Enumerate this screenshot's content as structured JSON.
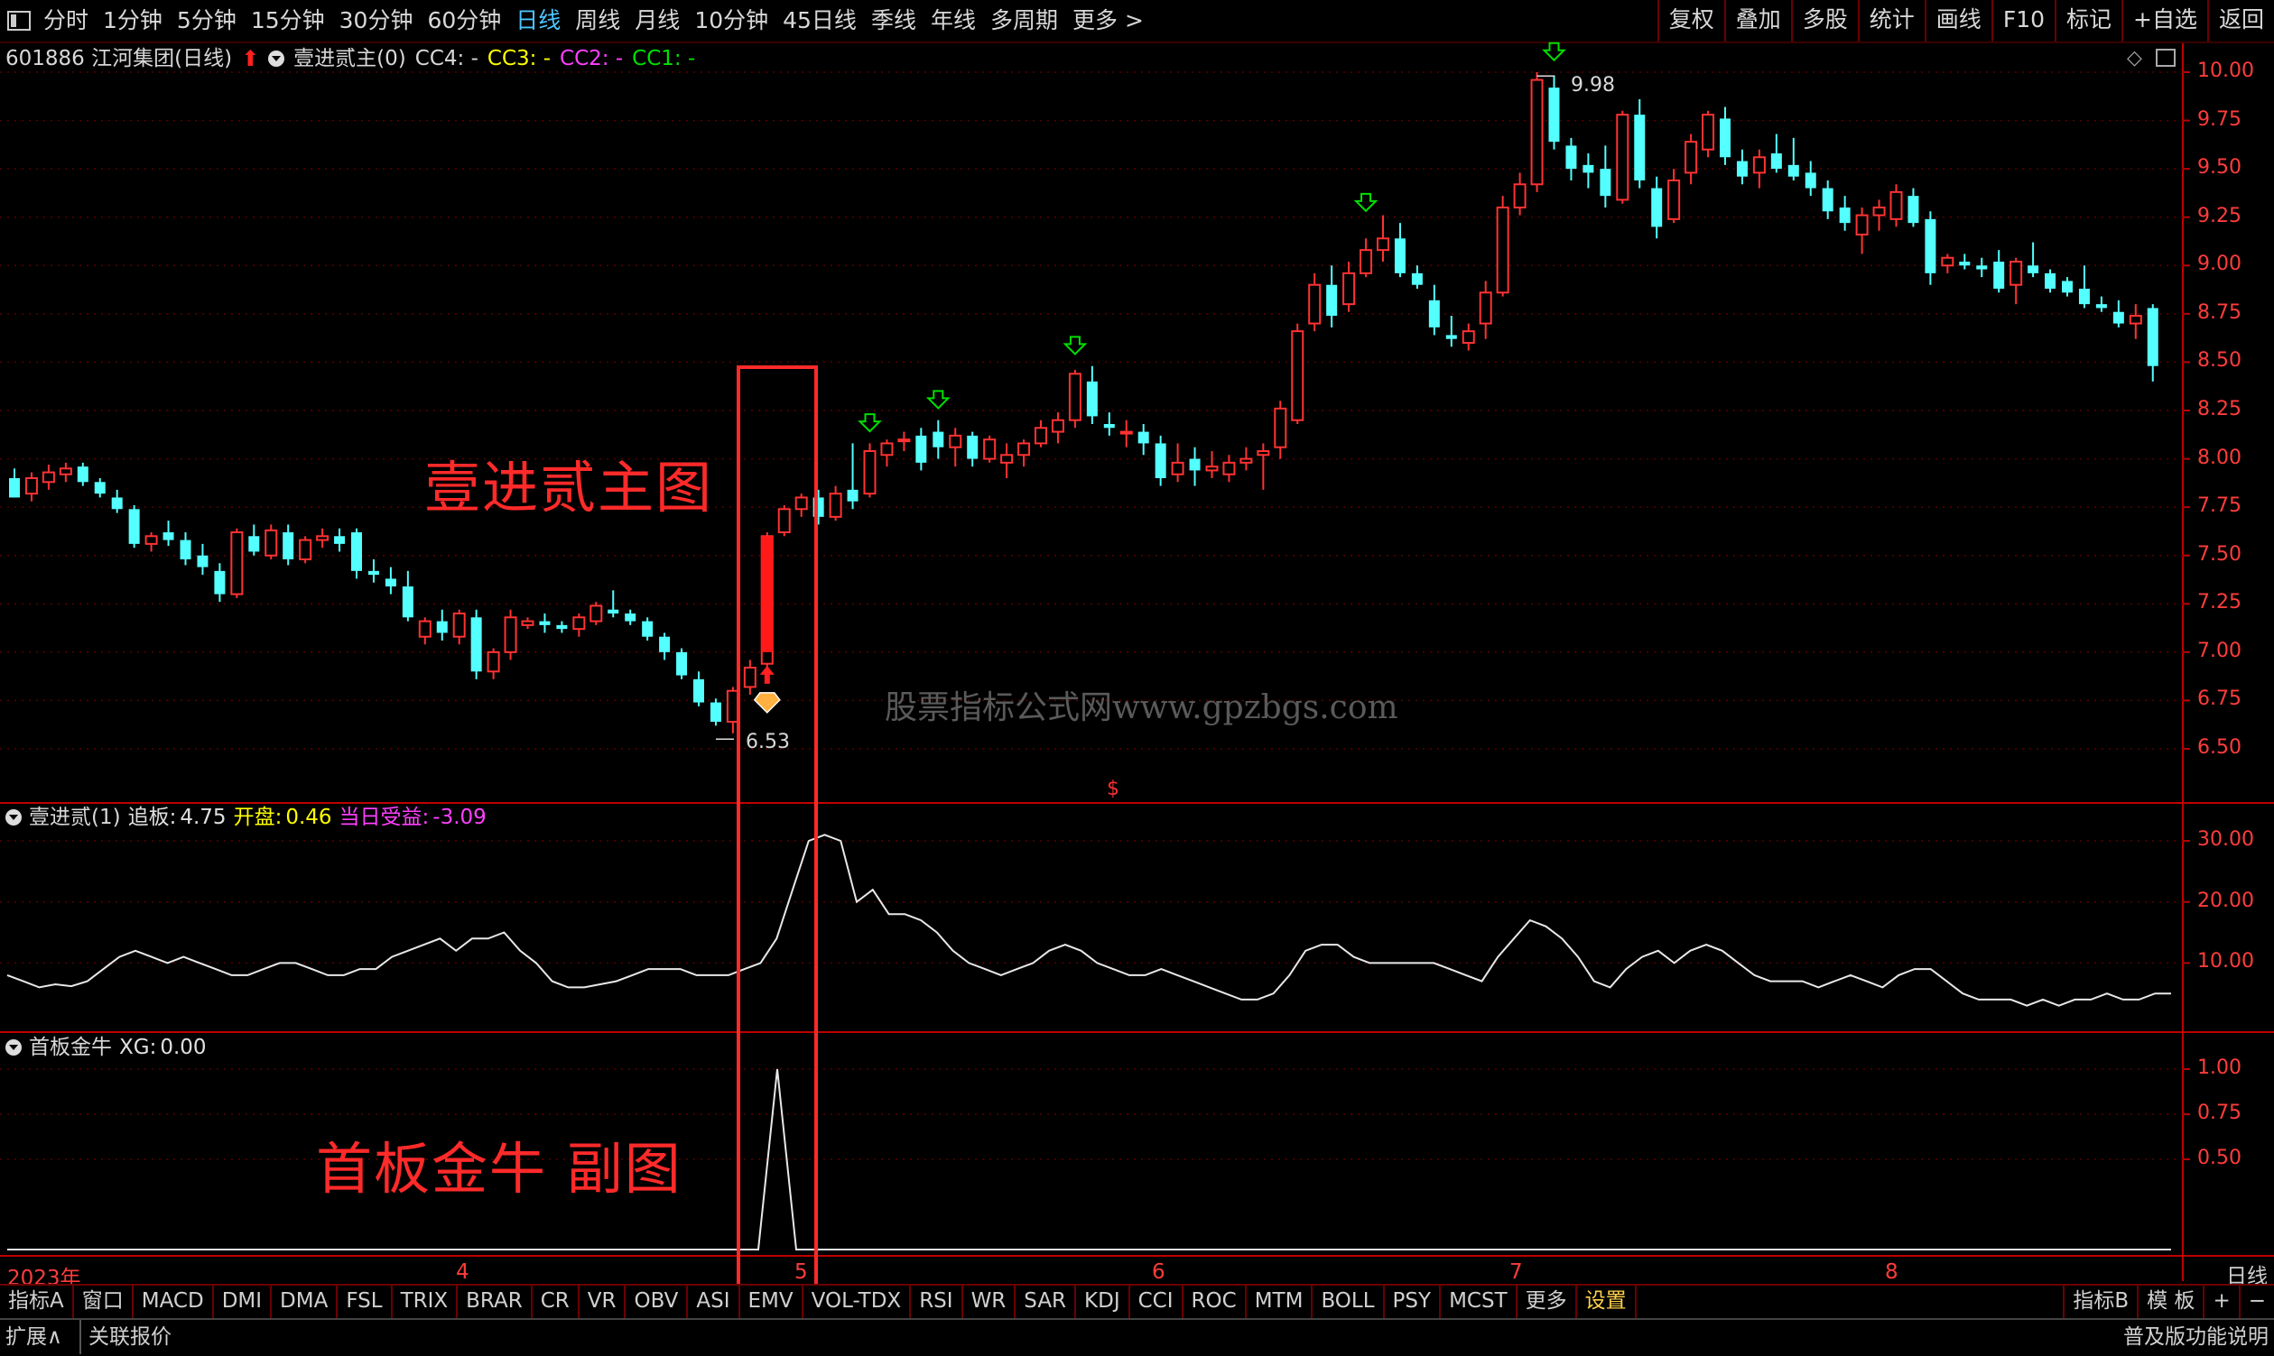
{
  "toolbar": {
    "periods": [
      "分时",
      "1分钟",
      "5分钟",
      "15分钟",
      "30分钟",
      "60分钟",
      "日线",
      "周线",
      "月线",
      "10分钟",
      "45日线",
      "季线",
      "年线",
      "多周期",
      "更多"
    ],
    "active_period": "日线",
    "more_arrow": ">",
    "right_buttons": [
      "复权",
      "叠加",
      "多股",
      "统计",
      "画线",
      "F10",
      "标记",
      "+自选",
      "返回"
    ]
  },
  "info": {
    "stock": "601886 江河集团(日线)",
    "indicator": "壹进贰主(0)",
    "cc4": "CC4: -",
    "cc3": "CC3: -",
    "cc2": "CC2: -",
    "cc1": "CC1: -",
    "colors": {
      "cc4": "#d8d8d8",
      "cc3": "#ffff00",
      "cc2": "#ff40ff",
      "cc1": "#00ff00"
    }
  },
  "main_axis": {
    "ticks": [
      "10.00",
      "9.75",
      "9.50",
      "9.25",
      "9.00",
      "8.75",
      "8.50",
      "8.25",
      "8.00",
      "7.75",
      "7.50",
      "7.25",
      "7.00",
      "6.75",
      "6.50"
    ],
    "high_label": "9.98",
    "low_label": "6.53"
  },
  "sub1": {
    "name": "壹进贰(1)",
    "zhuiban_label": "追板:",
    "zhuiban_value": "4.75",
    "kaipan_label": "开盘:",
    "kaipan_value": "0.46",
    "dangri_label": "当日受益:",
    "dangri_value": "-3.09",
    "ticks": [
      "30.00",
      "20.00",
      "10.00"
    ]
  },
  "sub2": {
    "name": "首板金牛",
    "xg_label": "XG:",
    "xg_value": "0.00",
    "ticks": [
      "1.00",
      "0.75",
      "0.50"
    ]
  },
  "overlay": {
    "main_text": "壹进贰主图",
    "sub_text": "首板金牛 副图"
  },
  "watermark": "股票指标公式网www.gpzbgs.com",
  "dollar_mark": "$",
  "dates": [
    "2023年",
    "4",
    "5",
    "6",
    "7",
    "8"
  ],
  "period_label": "日线",
  "bottom_tabs": [
    "指标A",
    "窗口",
    "MACD",
    "DMI",
    "DMA",
    "FSL",
    "TRIX",
    "BRAR",
    "CR",
    "VR",
    "OBV",
    "ASI",
    "EMV",
    "VOL-TDX",
    "RSI",
    "WR",
    "SAR",
    "KDJ",
    "CCI",
    "ROC",
    "MTM",
    "BOLL",
    "PSY",
    "MCST",
    "更多",
    "设置"
  ],
  "bottom_right": [
    "指标B",
    "模 板",
    "+",
    "−"
  ],
  "status": {
    "expand": "扩展∧",
    "quote": "关联报价",
    "help": "普及版功能说明"
  },
  "chart_data": {
    "type": "candlestick",
    "candles": [
      [
        7.9,
        7.95,
        7.8,
        7.8
      ],
      [
        7.82,
        7.93,
        7.78,
        7.9
      ],
      [
        7.88,
        7.97,
        7.84,
        7.93
      ],
      [
        7.92,
        7.98,
        7.88,
        7.95
      ],
      [
        7.96,
        7.98,
        7.86,
        7.88
      ],
      [
        7.88,
        7.9,
        7.8,
        7.82
      ],
      [
        7.8,
        7.84,
        7.72,
        7.74
      ],
      [
        7.74,
        7.76,
        7.54,
        7.56
      ],
      [
        7.56,
        7.62,
        7.52,
        7.6
      ],
      [
        7.62,
        7.68,
        7.55,
        7.58
      ],
      [
        7.58,
        7.62,
        7.45,
        7.48
      ],
      [
        7.5,
        7.56,
        7.4,
        7.44
      ],
      [
        7.42,
        7.46,
        7.26,
        7.3
      ],
      [
        7.3,
        7.64,
        7.28,
        7.62
      ],
      [
        7.6,
        7.66,
        7.5,
        7.52
      ],
      [
        7.5,
        7.66,
        7.48,
        7.63
      ],
      [
        7.62,
        7.66,
        7.45,
        7.48
      ],
      [
        7.48,
        7.6,
        7.46,
        7.58
      ],
      [
        7.58,
        7.64,
        7.54,
        7.6
      ],
      [
        7.6,
        7.64,
        7.52,
        7.56
      ],
      [
        7.62,
        7.64,
        7.38,
        7.42
      ],
      [
        7.42,
        7.48,
        7.36,
        7.4
      ],
      [
        7.38,
        7.44,
        7.3,
        7.34
      ],
      [
        7.34,
        7.42,
        7.16,
        7.18
      ],
      [
        7.08,
        7.18,
        7.04,
        7.16
      ],
      [
        7.16,
        7.22,
        7.06,
        7.1
      ],
      [
        7.08,
        7.22,
        7.04,
        7.2
      ],
      [
        7.18,
        7.22,
        6.86,
        6.9
      ],
      [
        6.9,
        7.02,
        6.86,
        7.0
      ],
      [
        7.0,
        7.22,
        6.96,
        7.18
      ],
      [
        7.14,
        7.18,
        7.12,
        7.16
      ],
      [
        7.16,
        7.2,
        7.1,
        7.14
      ],
      [
        7.14,
        7.16,
        7.1,
        7.12
      ],
      [
        7.12,
        7.2,
        7.08,
        7.18
      ],
      [
        7.16,
        7.26,
        7.14,
        7.24
      ],
      [
        7.22,
        7.32,
        7.18,
        7.2
      ],
      [
        7.2,
        7.22,
        7.14,
        7.16
      ],
      [
        7.16,
        7.18,
        7.06,
        7.08
      ],
      [
        7.08,
        7.1,
        6.96,
        7.0
      ],
      [
        7.0,
        7.02,
        6.86,
        6.88
      ],
      [
        6.86,
        6.9,
        6.72,
        6.74
      ],
      [
        6.74,
        6.76,
        6.62,
        6.64
      ],
      [
        6.64,
        6.82,
        6.58,
        6.8
      ],
      [
        6.82,
        6.96,
        6.78,
        6.92
      ],
      [
        6.94,
        7.62,
        6.92,
        7.6
      ],
      [
        7.62,
        7.76,
        7.6,
        7.74
      ],
      [
        7.74,
        7.82,
        7.7,
        7.8
      ],
      [
        7.8,
        7.84,
        7.66,
        7.7
      ],
      [
        7.7,
        7.86,
        7.68,
        7.82
      ],
      [
        7.84,
        8.08,
        7.74,
        7.78
      ],
      [
        7.82,
        8.08,
        7.8,
        8.04
      ],
      [
        8.02,
        8.1,
        7.96,
        8.08
      ],
      [
        8.1,
        8.14,
        8.04,
        8.1
      ],
      [
        8.12,
        8.16,
        7.94,
        7.98
      ],
      [
        8.14,
        8.2,
        8.0,
        8.06
      ],
      [
        8.06,
        8.16,
        7.96,
        8.12
      ],
      [
        8.12,
        8.14,
        7.96,
        8.0
      ],
      [
        8.0,
        8.12,
        7.98,
        8.1
      ],
      [
        7.98,
        8.08,
        7.9,
        8.02
      ],
      [
        8.02,
        8.1,
        7.96,
        8.08
      ],
      [
        8.08,
        8.2,
        8.06,
        8.16
      ],
      [
        8.14,
        8.24,
        8.08,
        8.2
      ],
      [
        8.2,
        8.46,
        8.16,
        8.44
      ],
      [
        8.4,
        8.48,
        8.18,
        8.22
      ],
      [
        8.18,
        8.24,
        8.12,
        8.16
      ],
      [
        8.14,
        8.2,
        8.06,
        8.14
      ],
      [
        8.14,
        8.18,
        8.02,
        8.08
      ],
      [
        8.08,
        8.12,
        7.86,
        7.9
      ],
      [
        7.92,
        8.08,
        7.88,
        7.98
      ],
      [
        8.0,
        8.06,
        7.86,
        7.94
      ],
      [
        7.94,
        8.04,
        7.9,
        7.96
      ],
      [
        7.92,
        8.02,
        7.88,
        7.98
      ],
      [
        7.98,
        8.06,
        7.94,
        8.0
      ],
      [
        8.02,
        8.08,
        7.84,
        8.04
      ],
      [
        8.06,
        8.3,
        8.0,
        8.26
      ],
      [
        8.2,
        8.7,
        8.18,
        8.66
      ],
      [
        8.7,
        8.96,
        8.66,
        8.9
      ],
      [
        8.9,
        9.0,
        8.68,
        8.74
      ],
      [
        8.8,
        9.02,
        8.76,
        8.96
      ],
      [
        8.96,
        9.14,
        8.94,
        9.08
      ],
      [
        9.08,
        9.26,
        9.02,
        9.14
      ],
      [
        9.14,
        9.22,
        8.94,
        8.96
      ],
      [
        8.96,
        9.0,
        8.88,
        8.9
      ],
      [
        8.82,
        8.9,
        8.64,
        8.68
      ],
      [
        8.64,
        8.74,
        8.58,
        8.62
      ],
      [
        8.6,
        8.7,
        8.56,
        8.66
      ],
      [
        8.7,
        8.92,
        8.62,
        8.86
      ],
      [
        8.86,
        9.36,
        8.84,
        9.3
      ],
      [
        9.3,
        9.48,
        9.26,
        9.42
      ],
      [
        9.42,
        10.0,
        9.38,
        9.96
      ],
      [
        9.92,
        9.98,
        9.6,
        9.64
      ],
      [
        9.62,
        9.66,
        9.44,
        9.5
      ],
      [
        9.52,
        9.58,
        9.4,
        9.48
      ],
      [
        9.5,
        9.62,
        9.3,
        9.36
      ],
      [
        9.34,
        9.8,
        9.32,
        9.78
      ],
      [
        9.78,
        9.86,
        9.4,
        9.44
      ],
      [
        9.4,
        9.46,
        9.14,
        9.2
      ],
      [
        9.24,
        9.5,
        9.22,
        9.44
      ],
      [
        9.48,
        9.68,
        9.42,
        9.64
      ],
      [
        9.6,
        9.8,
        9.56,
        9.78
      ],
      [
        9.76,
        9.82,
        9.52,
        9.56
      ],
      [
        9.54,
        9.6,
        9.42,
        9.46
      ],
      [
        9.48,
        9.6,
        9.4,
        9.56
      ],
      [
        9.58,
        9.68,
        9.48,
        9.5
      ],
      [
        9.52,
        9.66,
        9.44,
        9.46
      ],
      [
        9.48,
        9.54,
        9.36,
        9.4
      ],
      [
        9.4,
        9.44,
        9.24,
        9.28
      ],
      [
        9.3,
        9.36,
        9.18,
        9.22
      ],
      [
        9.16,
        9.3,
        9.06,
        9.26
      ],
      [
        9.26,
        9.34,
        9.18,
        9.3
      ],
      [
        9.24,
        9.42,
        9.2,
        9.38
      ],
      [
        9.36,
        9.4,
        9.2,
        9.22
      ],
      [
        9.24,
        9.28,
        8.9,
        8.96
      ],
      [
        9.0,
        9.06,
        8.96,
        9.04
      ],
      [
        9.02,
        9.06,
        8.98,
        9.0
      ],
      [
        9.0,
        9.04,
        8.94,
        8.98
      ],
      [
        9.02,
        9.08,
        8.86,
        8.88
      ],
      [
        8.9,
        9.04,
        8.8,
        9.02
      ],
      [
        9.0,
        9.12,
        8.94,
        8.96
      ],
      [
        8.96,
        8.98,
        8.86,
        8.88
      ],
      [
        8.92,
        8.94,
        8.84,
        8.86
      ],
      [
        8.88,
        9.0,
        8.78,
        8.8
      ],
      [
        8.8,
        8.84,
        8.76,
        8.78
      ],
      [
        8.76,
        8.82,
        8.68,
        8.7
      ],
      [
        8.7,
        8.8,
        8.62,
        8.74
      ],
      [
        8.78,
        8.8,
        8.4,
        8.48
      ]
    ],
    "sub1_line": [
      8,
      7,
      6,
      6.5,
      6.2,
      7,
      9,
      11,
      12,
      11,
      10,
      11,
      10,
      9,
      8,
      8,
      9,
      10,
      10,
      9,
      8,
      8,
      9,
      9,
      11,
      12,
      13,
      14,
      12,
      14,
      14,
      15,
      12,
      10,
      7,
      6,
      6,
      6.5,
      7,
      8,
      9,
      9,
      9,
      8,
      8,
      8,
      9,
      10,
      14,
      22,
      30,
      31,
      30,
      20,
      22,
      18,
      18,
      17,
      15,
      12,
      10,
      9,
      8,
      9,
      10,
      12,
      13,
      12,
      10,
      9,
      8,
      8,
      9,
      8,
      7,
      6,
      5,
      4,
      4,
      5,
      8,
      12,
      13,
      13,
      11,
      10,
      10,
      10,
      10,
      10,
      9,
      8,
      7,
      11,
      14,
      17,
      16,
      14,
      11,
      7,
      6,
      9,
      11,
      12,
      10,
      12,
      13,
      12,
      10,
      8,
      7,
      7,
      7,
      6,
      7,
      8,
      7,
      6,
      8,
      9,
      9,
      7,
      5,
      4,
      4,
      4,
      3,
      4,
      3,
      4,
      4,
      5,
      4,
      4,
      5,
      5
    ]
  }
}
